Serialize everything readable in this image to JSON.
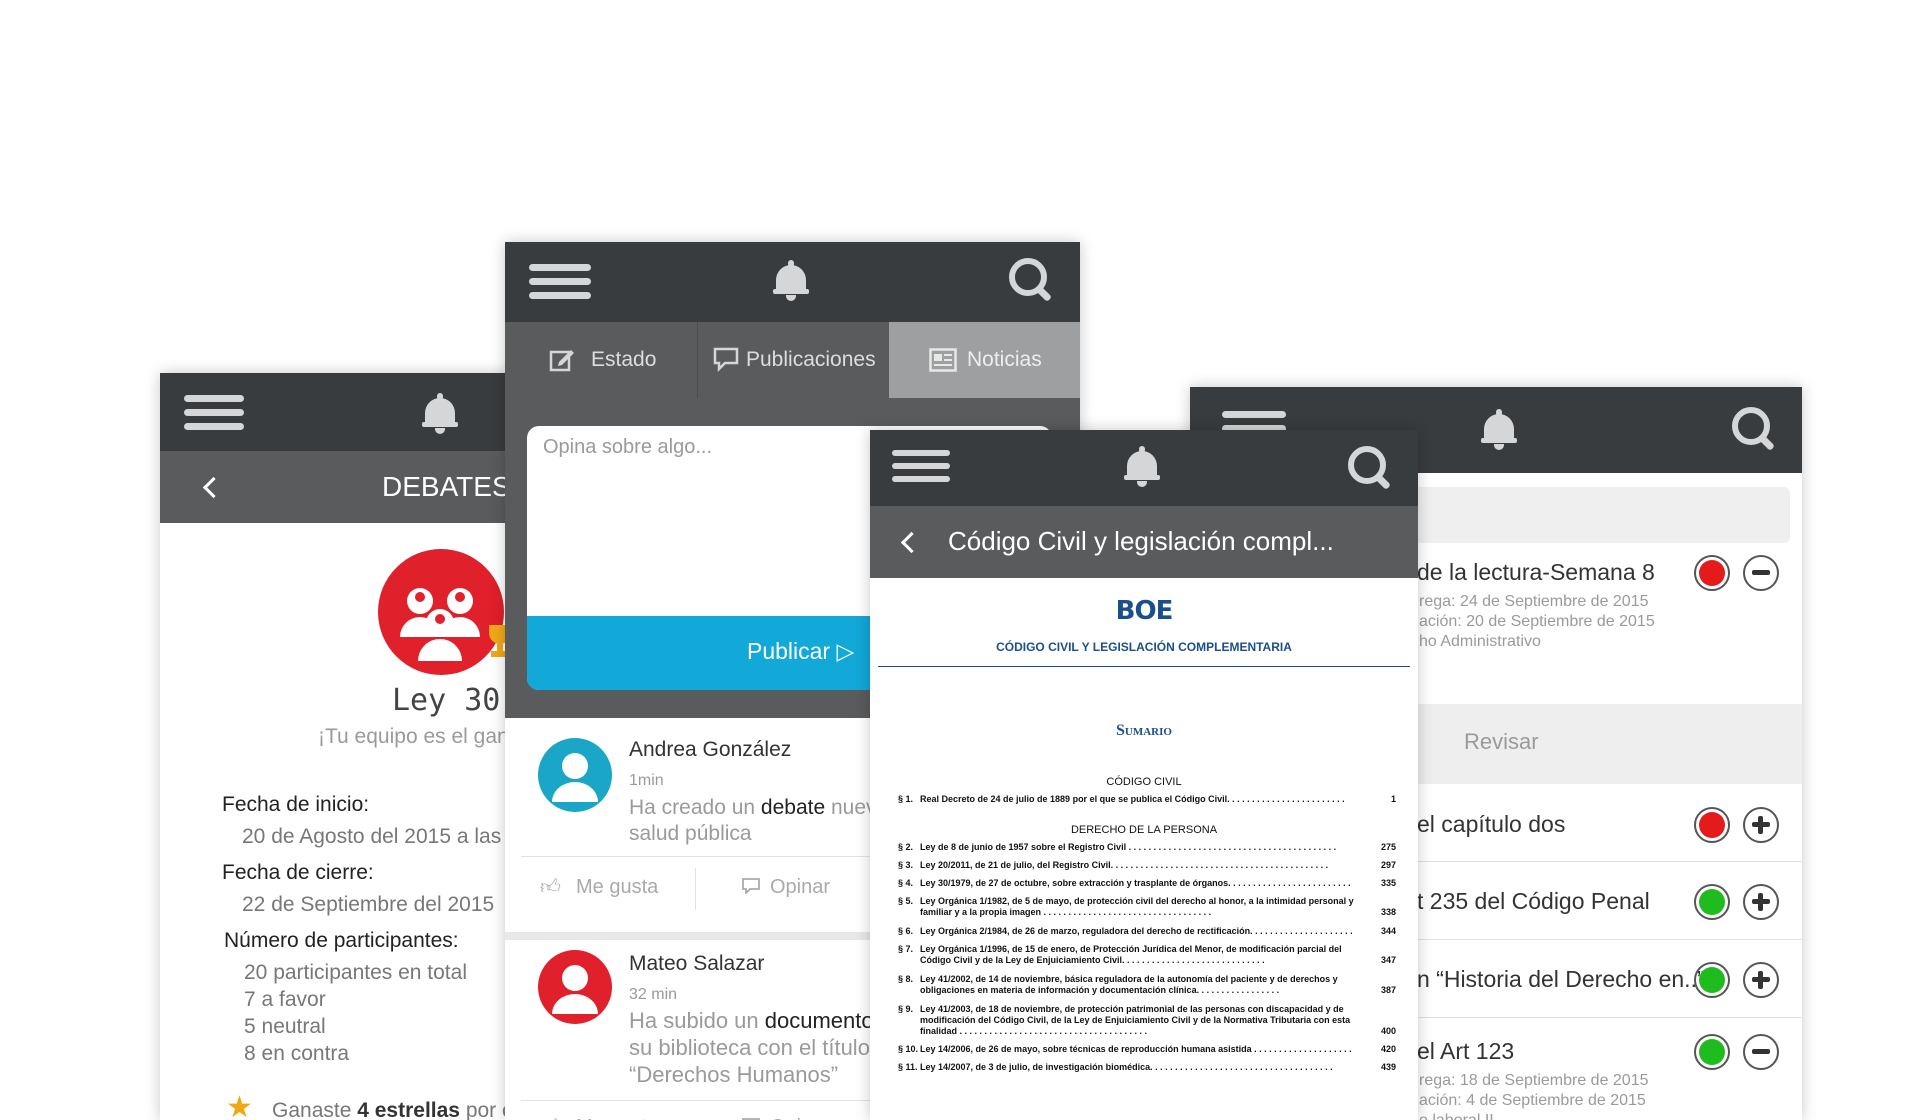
{
  "debates": {
    "title": "DEBATES",
    "law": "Ley 30",
    "team_message": "¡Tu equipo es el gan",
    "start_label": "Fecha de inicio:",
    "start_value": "20 de Agosto del 2015 a las",
    "end_label": "Fecha de cierre:",
    "end_value": "22 de Septiembre del 2015",
    "participants_label": "Número de participantes:",
    "participants_total": "20 participantes en total",
    "participants_favor": "7 a favor",
    "participants_neutral": "5 neutral",
    "participants_against": "8 en contra",
    "stars_prefix": "Ganaste ",
    "stars_bold": "4 estrellas",
    "stars_suffix": " por c",
    "colors": {
      "accent": "#e0202b",
      "trophy": "#f0a818"
    }
  },
  "feed": {
    "tabs": [
      {
        "label": "Estado",
        "icon": "edit-icon"
      },
      {
        "label": "Publicaciones",
        "icon": "chat-icon"
      },
      {
        "label": "Noticias",
        "icon": "newspaper-icon"
      }
    ],
    "compose_placeholder": "Opina sobre algo...",
    "publish_label": "Publicar ▷",
    "posts": [
      {
        "author": "Andrea González",
        "time": "1min",
        "text_pre": "Ha creado un ",
        "text_bold": "debate",
        "text_post": " nuev",
        "text_line2": "salud pública",
        "avatar_color": "#1aa7c7"
      },
      {
        "author": "Mateo Salazar",
        "time": "32 min",
        "text_pre": "Ha subido un ",
        "text_bold": "documento",
        "text_post": "",
        "text_line2": "su biblioteca con el título",
        "text_line3": "“Derechos Humanos”",
        "avatar_color": "#e0202b"
      }
    ],
    "like_label": "Me gusta",
    "comment_label": "Opinar",
    "colors": {
      "publish_bg": "#12a8d8",
      "tabs_bg": "#595b5d",
      "active_tab_bg": "#9e9fa0"
    }
  },
  "document": {
    "title": "Código Civil y legislación compl...",
    "logo": "BOE",
    "heading": "CÓDIGO CIVIL Y LEGISLACIÓN COMPLEMENTARIA",
    "sumario": "Sumario",
    "section1": "CÓDIGO CIVIL",
    "section2": "DERECHO DE LA PERSONA",
    "entries_first": [
      {
        "num": "§ 1.",
        "text": "Real Decreto de 24 de julio de 1889 por el que se publica el Código Civil. . . . . . . . . . . . . . . . . . . . . . . .",
        "page": "1"
      }
    ],
    "entries": [
      {
        "num": "§ 2.",
        "text": "Ley de 8 de junio de 1957 sobre el Registro Civil . . . . . . . . . . . . . . . . . . . . . . . . . . . . . . . . . . . . . . . . . .",
        "page": "275"
      },
      {
        "num": "§ 3.",
        "text": "Ley 20/2011, de 21 de julio, del Registro Civil. . . . . . . . . . . . . . . . . . . . . . . . . . . . . . . . . . . . . . . . . . . .",
        "page": "297"
      },
      {
        "num": "§ 4.",
        "text": "Ley 30/1979, de 27 de octubre, sobre extracción y trasplante de órganos. . . . . . . . . . . . . . . . . . . . . . . . .",
        "page": "335"
      },
      {
        "num": "§ 5.",
        "text": "Ley Orgánica 1/1982, de 5 de mayo, de protección civil del derecho al honor, a la intimidad personal y familiar y a la propia imagen . . . . . . . . . . . . . . . . . . . . . . . . . . . . . . . . . .",
        "page": "338"
      },
      {
        "num": "§ 6.",
        "text": "Ley Orgánica 2/1984, de 26 de marzo, reguladora del derecho de rectificación. . . . . . . . . . . . . . . . . . . . .",
        "page": "344"
      },
      {
        "num": "§ 7.",
        "text": "Ley Orgánica 1/1996, de 15 de enero, de Protección Jurídica del Menor, de modificación parcial del Código Civil y de la Ley de Enjuiciamiento Civil. . . . . . . . . . . . . . . . . . . . . . . . . . . . .",
        "page": "347"
      },
      {
        "num": "§ 8.",
        "text": "Ley 41/2002, de 14 de noviembre, básica reguladora de la autonomía del paciente y de derechos y obligaciones en materia de información y documentación clínica. . . . . . . . . . . . . . . . .",
        "page": "387"
      },
      {
        "num": "§ 9.",
        "text": "Ley 41/2003, de 18 de noviembre, de protección patrimonial de las personas con discapacidad y de modificación del Código Civil, de la Ley de Enjuiciamiento Civil y de la Normativa Tributaria con esta finalidad . . . . . . . . . . . . . . . . . . . . . . . . . . . . . . . . . . . . . .",
        "page": "400"
      },
      {
        "num": "§ 10.",
        "text": "Ley 14/2006, de 26 de mayo, sobre técnicas de reproducción humana asistida . . . . . . . . . . . . . . . . . . . .",
        "page": "420"
      },
      {
        "num": "§ 11.",
        "text": "Ley 14/2007, de 3 de julio, de investigación biomédica. . . . . . . . . . . . . . . . . . . . . . . . . . . . . . . . . . . . .",
        "page": "439"
      }
    ],
    "colors": {
      "brand": "#1a4f8c"
    }
  },
  "tasks": {
    "revisar_label": "Revisar",
    "items": [
      {
        "title": "de la lectura-Semana 8",
        "line1": "rega: 24 de Septiembre de 2015",
        "line2": "ación: 20 de Septiembre de 2015",
        "line3": "ho Administrativo",
        "status": "red",
        "action": "minus"
      },
      {
        "title": "el capítulo dos",
        "status": "red",
        "action": "plus"
      },
      {
        "title": "t 235 del Código Penal",
        "status": "green",
        "action": "plus"
      },
      {
        "title": "n “Historia del Derecho en..”",
        "status": "green",
        "action": "plus"
      },
      {
        "title": "el Art 123",
        "line1": "rega: 18 de Septiembre de 2015",
        "line2": "ación: 4 de Septiembre de 2015",
        "line3": "o laboral II",
        "status": "green",
        "action": "minus"
      }
    ],
    "colors": {
      "red": "#e51b1b",
      "green": "#1ebc1e"
    }
  }
}
